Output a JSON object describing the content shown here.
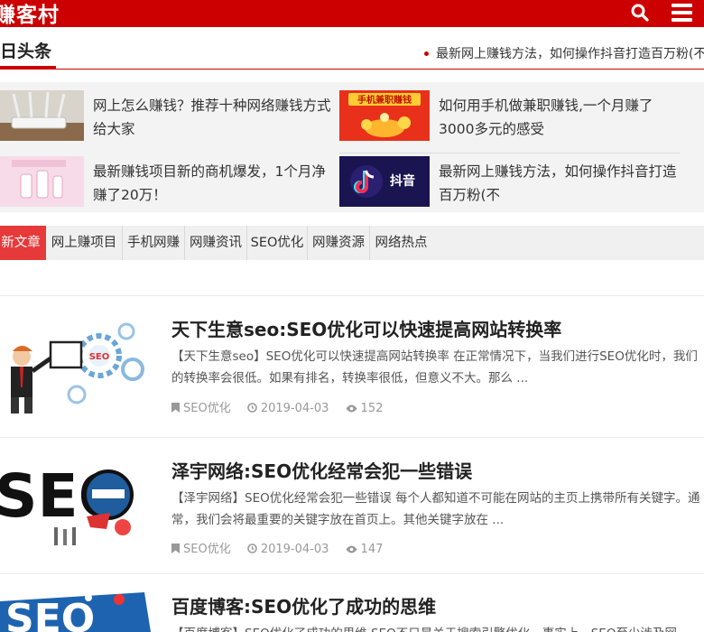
{
  "header": {
    "logo_text": "赚客村",
    "search_icon": "search-icon",
    "menu_icon": "menu-icon",
    "brand_color": "#cc0000"
  },
  "headlines": {
    "title": "日头条",
    "ticker_text": "最新网上赚钱方法，如何操作抖音打造百万粉(不"
  },
  "featured": [
    {
      "title": "网上怎么赚钱？推荐十种网络赚钱方式给大家",
      "thumb": "wifi-router"
    },
    {
      "title": "如何用手机做兼职赚钱,一个月赚了3000多元的感受",
      "thumb_caption": "手机兼职赚钱"
    },
    {
      "title": "最新赚钱项目新的商机爆发，1个月净赚了20万！",
      "thumb": "pink-product"
    },
    {
      "title": "最新网上赚钱方法，如何操作抖音打造百万粉(不",
      "thumb_caption": "抖音"
    }
  ],
  "tabs": [
    {
      "label": "新文章",
      "active": true
    },
    {
      "label": "网上赚项目",
      "active": false
    },
    {
      "label": "手机网赚",
      "active": false
    },
    {
      "label": "网赚资讯",
      "active": false
    },
    {
      "label": "SEO优化",
      "active": false
    },
    {
      "label": "网赚资源",
      "active": false
    },
    {
      "label": "网络热点",
      "active": false
    }
  ],
  "articles": [
    {
      "title": "天下生意seo:SEO优化可以快速提高网站转换率",
      "excerpt": "【天下生意seo】SEO优化可以快速提高网站转换率 在正常情况下，当我们进行SEO优化时，我们的转换率会很低。如果有排名，转换率很低，但意义不大。那么 ...",
      "category": "SEO优化",
      "date": "2019-04-03",
      "views": "152",
      "thumb_text": "SEO"
    },
    {
      "title": "泽宇网络:SEO优化经常会犯一些错误",
      "excerpt": "【泽宇网络】SEO优化经常会犯一些错误 每个人都知道不可能在网站的主页上携带所有关键字。通常，我们会将最重要的关键字放在首页上。其他关键字放在 ...",
      "category": "SEO优化",
      "date": "2019-04-03",
      "views": "147",
      "thumb_text": "SEO"
    },
    {
      "title": "百度博客:SEO优化了成功的思维",
      "excerpt": "【百度博客】SEO优化了成功的思维 SEO不只是关于搜索引擎优化，事实上，SEO至少涉及网",
      "thumb_text": "SEO"
    }
  ]
}
